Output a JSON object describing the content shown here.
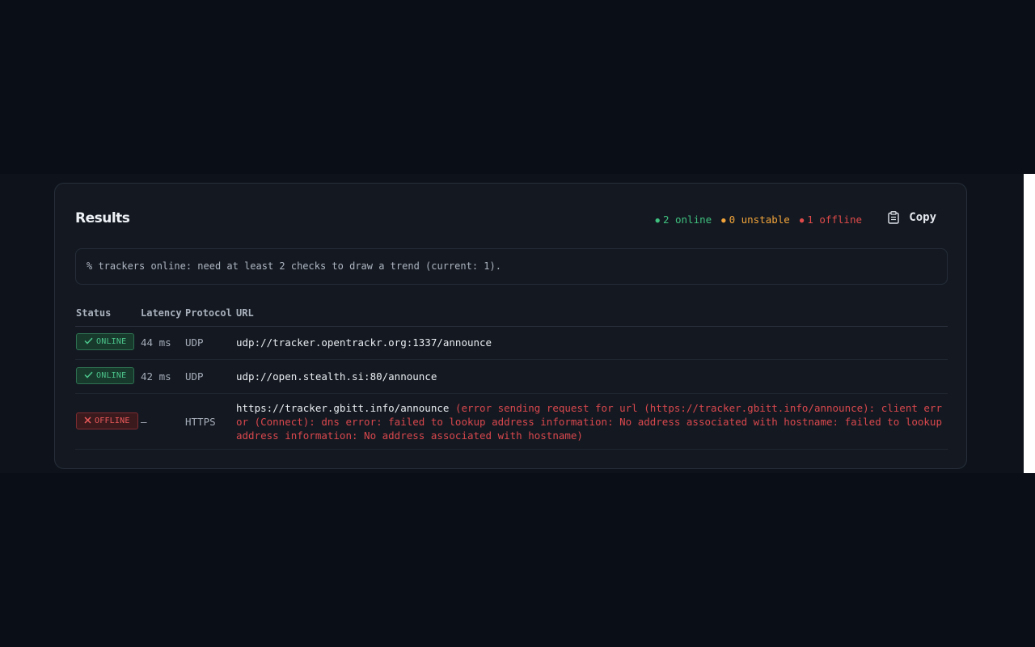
{
  "panel": {
    "title": "Results",
    "summary": {
      "online": "2 online",
      "unstable": "0 unstable",
      "offline": "1 offline"
    },
    "copy_label": "Copy",
    "notice": "% trackers online: need at least 2 checks to draw a trend (current: 1)."
  },
  "table": {
    "headers": {
      "status": "Status",
      "latency": "Latency",
      "protocol": "Protocol",
      "url": "URL"
    },
    "rows": [
      {
        "status": "ONLINE",
        "latency": "44 ms",
        "protocol": "UDP",
        "url": "udp://tracker.opentrackr.org:1337/announce",
        "error": ""
      },
      {
        "status": "ONLINE",
        "latency": "42 ms",
        "protocol": "UDP",
        "url": "udp://open.stealth.si:80/announce",
        "error": ""
      },
      {
        "status": "OFFLINE",
        "latency": "—",
        "protocol": "HTTPS",
        "url": "https://tracker.gbitt.info/announce",
        "error": "(error sending request for url (https://tracker.gbitt.info/announce): client error (Connect): dns error: failed to lookup address information: No address associated with hostname: failed to lookup address information: No address associated with hostname)"
      }
    ]
  },
  "colors": {
    "online": "#3fc07f",
    "unstable": "#f2a33a",
    "offline": "#e04a4a",
    "background": "#0a0e16",
    "card": "#141921"
  },
  "icons": {
    "online_badge": "check-icon",
    "offline_badge": "x-icon",
    "copy": "clipboard-icon"
  }
}
